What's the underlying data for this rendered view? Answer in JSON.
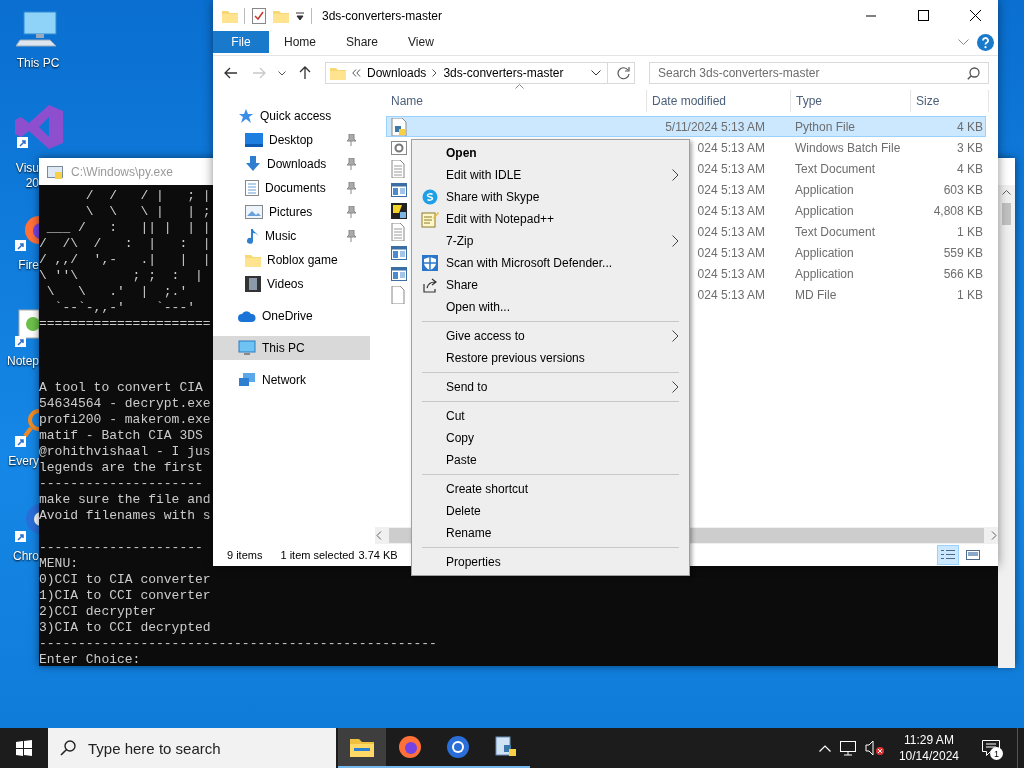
{
  "desktop_icons": [
    {
      "label_lines": [
        "This PC"
      ]
    },
    {
      "label_lines": [
        "Visu",
        "20"
      ]
    },
    {
      "label_lines": [
        "Fire"
      ]
    },
    {
      "label_lines": [
        "Notep"
      ]
    },
    {
      "label_lines": [
        "Every"
      ]
    },
    {
      "label_lines": [
        "Chro"
      ]
    }
  ],
  "console": {
    "title": "C:\\Windows\\py.exe",
    "blocks": [
      [
        "      /  /   / |   ; |",
        "      \\  \\   \\ |   | ;",
        " ___ /   :   || |  | |",
        "/  /\\  /   :  |   :  |",
        "/ ,,/  ',-   .|   |  |",
        "\\ ''\\       ; ;  :  |",
        " \\   \\   .'  |  ;.'",
        "  `--`-,,-'    `---'",
        "======================"
      ],
      [
        "A tool to convert CIA",
        "54634564 - decrypt.exe",
        "profi200 - makerom.exe",
        "matif - Batch CIA 3DS",
        "@rohithvishaal - I jus",
        "legends are the first",
        "---------------------",
        "make sure the file and",
        "Avoid filenames with s"
      ],
      [
        "---------------------",
        "MENU:",
        "0)CCI to CIA converter",
        "1)CIA to CCI converter",
        "2)CCI decrypter",
        "3)CIA to CCI decrypted",
        "---------------------------------------------------",
        "Enter Choice:"
      ]
    ]
  },
  "explorer": {
    "title": "3ds-converters-master",
    "ribbon_tabs": [
      {
        "label": "File",
        "kind": "file"
      },
      {
        "label": "Home",
        "kind": "tab"
      },
      {
        "label": "Share",
        "kind": "tab"
      },
      {
        "label": "View",
        "kind": "tab"
      }
    ],
    "forward_disabled": true,
    "breadcrumb": [
      "Downloads",
      "3ds-converters-master"
    ],
    "search": {
      "placeholder": "Search 3ds-converters-master"
    },
    "nav": [
      {
        "label": "Quick access",
        "selected": false,
        "children": [
          {
            "label": "Desktop",
            "selected": false,
            "pinned": true
          },
          {
            "label": "Downloads",
            "selected": false,
            "pinned": true
          },
          {
            "label": "Documents",
            "selected": false,
            "pinned": true
          },
          {
            "label": "Pictures",
            "selected": false,
            "pinned": true
          },
          {
            "label": "Music",
            "selected": false,
            "pinned": true
          },
          {
            "label": "Roblox game",
            "selected": false,
            "pinned": false
          },
          {
            "label": "Videos",
            "selected": false,
            "pinned": false
          }
        ]
      },
      {
        "label": "OneDrive",
        "selected": false
      },
      {
        "label": "This PC",
        "selected": true
      },
      {
        "label": "Network",
        "selected": false
      }
    ],
    "columns": [
      "Name",
      "Date modified",
      "Type",
      "Size"
    ],
    "rows": [
      {
        "kind": "python",
        "date": "5/11/2024 5:13 AM",
        "type": "Python File",
        "size": "4 KB",
        "selected": true
      },
      {
        "kind": "batch",
        "date": "024 5:13 AM",
        "type": "Windows Batch File",
        "size": "3 KB",
        "selected": false
      },
      {
        "kind": "text",
        "date": "024 5:13 AM",
        "type": "Text Document",
        "size": "4 KB",
        "selected": false
      },
      {
        "kind": "app",
        "date": "024 5:13 AM",
        "type": "Application",
        "size": "603 KB",
        "selected": false
      },
      {
        "kind": "npp",
        "date": "024 5:13 AM",
        "type": "Application",
        "size": "4,808 KB",
        "selected": false
      },
      {
        "kind": "text",
        "date": "024 5:13 AM",
        "type": "Text Document",
        "size": "1 KB",
        "selected": false
      },
      {
        "kind": "app",
        "date": "024 5:13 AM",
        "type": "Application",
        "size": "559 KB",
        "selected": false
      },
      {
        "kind": "app",
        "date": "024 5:13 AM",
        "type": "Application",
        "size": "566 KB",
        "selected": false
      },
      {
        "kind": "md",
        "date": "024 5:13 AM",
        "type": "MD File",
        "size": "1 KB",
        "selected": false
      }
    ],
    "status": {
      "count": "9 items",
      "selection": "1 item selected",
      "size": "3.74 KB"
    },
    "views": [
      {
        "selected": true
      },
      {
        "selected": false
      }
    ]
  },
  "context_menu": {
    "groups": [
      [
        {
          "label": "Open",
          "default": true,
          "submenu": false
        },
        {
          "label": "Edit with IDLE",
          "default": false,
          "submenu": true
        },
        {
          "label": "Share with Skype",
          "default": false,
          "submenu": false
        },
        {
          "label": "Edit with Notepad++",
          "default": false,
          "submenu": false
        },
        {
          "label": "7-Zip",
          "default": false,
          "submenu": true
        },
        {
          "label": "Scan with Microsoft Defender...",
          "default": false,
          "submenu": false
        },
        {
          "label": "Share",
          "default": false,
          "submenu": false
        },
        {
          "label": "Open with...",
          "default": false,
          "submenu": false
        }
      ],
      [
        {
          "label": "Give access to",
          "default": false,
          "submenu": true
        },
        {
          "label": "Restore previous versions",
          "default": false,
          "submenu": false
        }
      ],
      [
        {
          "label": "Send to",
          "default": false,
          "submenu": true
        }
      ],
      [
        {
          "label": "Cut",
          "default": false,
          "submenu": false
        },
        {
          "label": "Copy",
          "default": false,
          "submenu": false
        },
        {
          "label": "Paste",
          "default": false,
          "submenu": false
        }
      ],
      [
        {
          "label": "Create shortcut",
          "default": false,
          "submenu": false
        },
        {
          "label": "Delete",
          "default": false,
          "submenu": false
        },
        {
          "label": "Rename",
          "default": false,
          "submenu": false
        }
      ],
      [
        {
          "label": "Properties",
          "default": false,
          "submenu": false
        }
      ]
    ]
  },
  "taskbar": {
    "search": {
      "placeholder": "Type here to search"
    },
    "apps": [
      {
        "active": true
      },
      {
        "active": false
      },
      {
        "active": false
      },
      {
        "active": false
      }
    ],
    "clock": {
      "time": "11:29 AM",
      "date": "10/14/2024"
    },
    "notifications": "1"
  }
}
